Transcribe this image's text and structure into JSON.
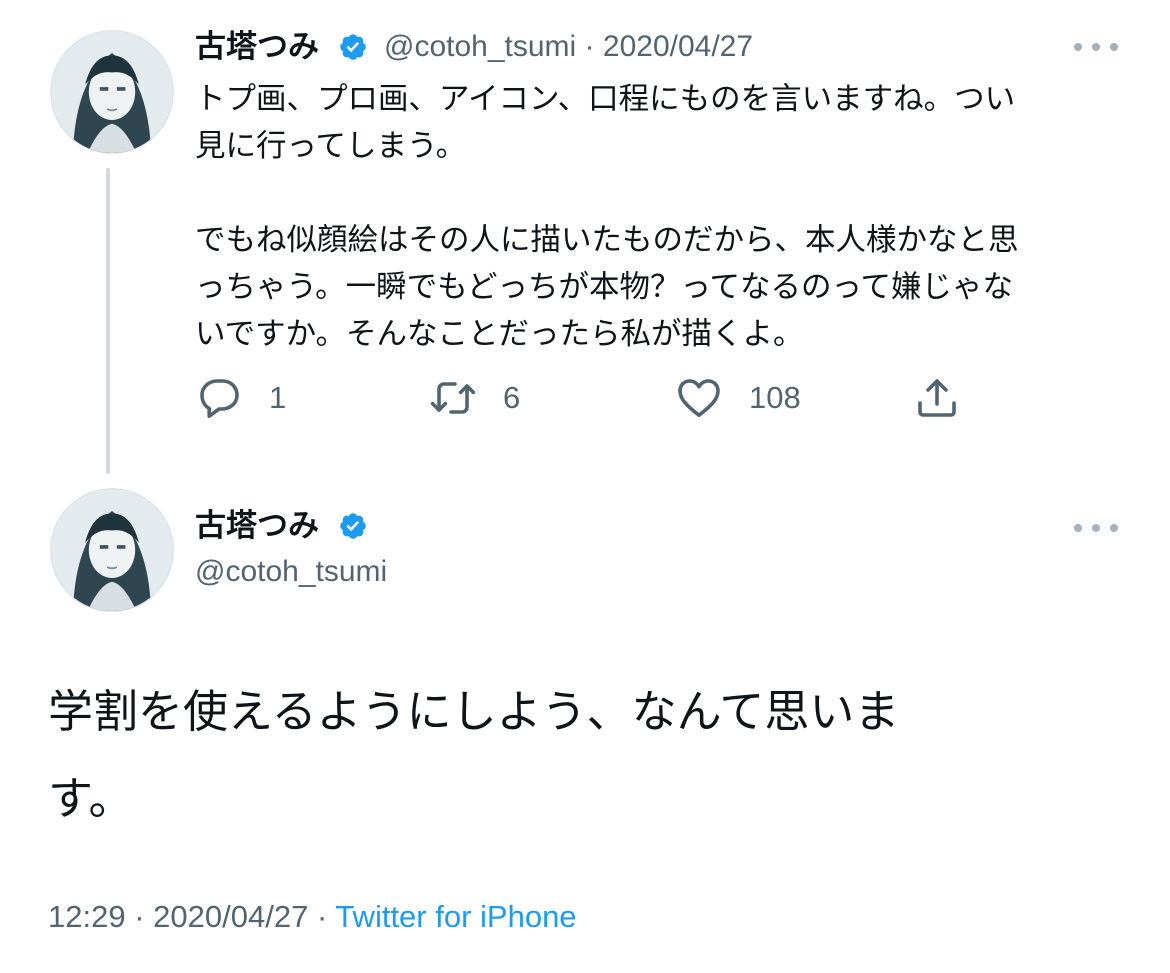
{
  "colors": {
    "text": "#0f1419",
    "secondary": "#536471",
    "link": "#1d9bf0",
    "verified": "#1d9bf0",
    "thread_line": "#cfd9de"
  },
  "reply_tweet": {
    "avatar_icon": "user-avatar-icon",
    "display_name": "古塔つみ",
    "verified_icon": "verified-badge-icon",
    "handle": "@cotoh_tsumi",
    "separator": "·",
    "date": "2020/04/27",
    "more_icon": "more-options-icon",
    "text": "トプ画、プロ画、アイコン、口程にものを言いますね。つい\n見に行ってしまう。\n\nでもね似顔絵はその人に描いたものだから、本人様かなと思\nっちゃう。一瞬でもどっちが本物？ってなるのって嫌じゃな\nいですか。そんなことだったら私が描くよ。",
    "actions": {
      "reply": {
        "icon": "reply-icon",
        "count": "1"
      },
      "retweet": {
        "icon": "retweet-icon",
        "count": "6"
      },
      "like": {
        "icon": "like-heart-icon",
        "count": "108"
      },
      "share": {
        "icon": "share-icon"
      }
    }
  },
  "main_tweet": {
    "avatar_icon": "user-avatar-icon",
    "display_name": "古塔つみ",
    "verified_icon": "verified-badge-icon",
    "handle": "@cotoh_tsumi",
    "more_icon": "more-options-icon",
    "text": "学割を使えるようにしよう、なんて思いま\nす。",
    "time": "12:29",
    "separator": "·",
    "date": "2020/04/27",
    "separator2": "·",
    "source": "Twitter for iPhone"
  }
}
